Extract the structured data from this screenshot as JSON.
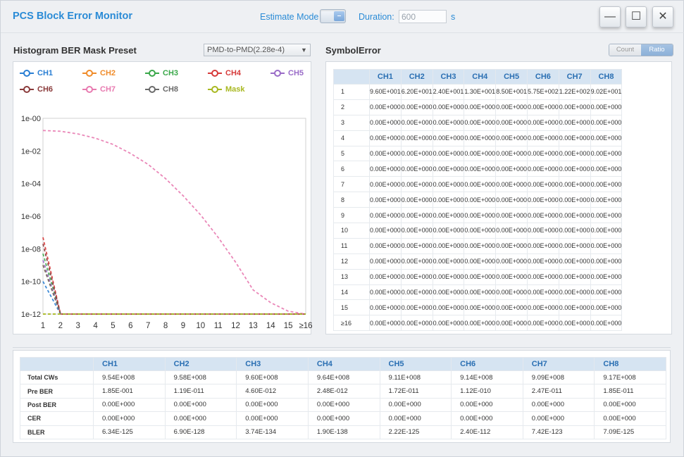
{
  "window": {
    "title": "PCS Block Error Monitor",
    "estimate_mode_label": "Estimate Mode",
    "estimate_mode_toggle": "–",
    "duration_label": "Duration:",
    "duration_value": "600",
    "duration_unit": "s",
    "minimize": "—",
    "maximize": "☐",
    "close": "✕"
  },
  "histogram": {
    "title": "Histogram BER Mask Preset",
    "preset_value": "PMD-to-PMD(2.28e-4)",
    "preset_arrow": "▼"
  },
  "symbol_error": {
    "title": "SymbolError",
    "modes": [
      "Count",
      "Ratio"
    ],
    "active_mode": "Ratio",
    "columns": [
      "",
      "CH1",
      "CH2",
      "CH3",
      "CH4",
      "CH5",
      "CH6",
      "CH7",
      "CH8"
    ],
    "rows": [
      [
        "1",
        "9.60E+001",
        "6.20E+001",
        "2.40E+001",
        "1.30E+001",
        "8.50E+001",
        "5.75E+002",
        "1.22E+002",
        "9.02E+001"
      ],
      [
        "2",
        "0.00E+000",
        "0.00E+000",
        "0.00E+000",
        "0.00E+000",
        "0.00E+000",
        "0.00E+000",
        "0.00E+000",
        "0.00E+000"
      ],
      [
        "3",
        "0.00E+000",
        "0.00E+000",
        "0.00E+000",
        "0.00E+000",
        "0.00E+000",
        "0.00E+000",
        "0.00E+000",
        "0.00E+000"
      ],
      [
        "4",
        "0.00E+000",
        "0.00E+000",
        "0.00E+000",
        "0.00E+000",
        "0.00E+000",
        "0.00E+000",
        "0.00E+000",
        "0.00E+000"
      ],
      [
        "5",
        "0.00E+000",
        "0.00E+000",
        "0.00E+000",
        "0.00E+000",
        "0.00E+000",
        "0.00E+000",
        "0.00E+000",
        "0.00E+000"
      ],
      [
        "6",
        "0.00E+000",
        "0.00E+000",
        "0.00E+000",
        "0.00E+000",
        "0.00E+000",
        "0.00E+000",
        "0.00E+000",
        "0.00E+000"
      ],
      [
        "7",
        "0.00E+000",
        "0.00E+000",
        "0.00E+000",
        "0.00E+000",
        "0.00E+000",
        "0.00E+000",
        "0.00E+000",
        "0.00E+000"
      ],
      [
        "8",
        "0.00E+000",
        "0.00E+000",
        "0.00E+000",
        "0.00E+000",
        "0.00E+000",
        "0.00E+000",
        "0.00E+000",
        "0.00E+000"
      ],
      [
        "9",
        "0.00E+000",
        "0.00E+000",
        "0.00E+000",
        "0.00E+000",
        "0.00E+000",
        "0.00E+000",
        "0.00E+000",
        "0.00E+000"
      ],
      [
        "10",
        "0.00E+000",
        "0.00E+000",
        "0.00E+000",
        "0.00E+000",
        "0.00E+000",
        "0.00E+000",
        "0.00E+000",
        "0.00E+000"
      ],
      [
        "11",
        "0.00E+000",
        "0.00E+000",
        "0.00E+000",
        "0.00E+000",
        "0.00E+000",
        "0.00E+000",
        "0.00E+000",
        "0.00E+000"
      ],
      [
        "12",
        "0.00E+000",
        "0.00E+000",
        "0.00E+000",
        "0.00E+000",
        "0.00E+000",
        "0.00E+000",
        "0.00E+000",
        "0.00E+000"
      ],
      [
        "13",
        "0.00E+000",
        "0.00E+000",
        "0.00E+000",
        "0.00E+000",
        "0.00E+000",
        "0.00E+000",
        "0.00E+000",
        "0.00E+000"
      ],
      [
        "14",
        "0.00E+000",
        "0.00E+000",
        "0.00E+000",
        "0.00E+000",
        "0.00E+000",
        "0.00E+000",
        "0.00E+000",
        "0.00E+000"
      ],
      [
        "15",
        "0.00E+000",
        "0.00E+000",
        "0.00E+000",
        "0.00E+000",
        "0.00E+000",
        "0.00E+000",
        "0.00E+000",
        "0.00E+000"
      ],
      [
        "≥16",
        "0.00E+000",
        "0.00E+000",
        "0.00E+000",
        "0.00E+000",
        "0.00E+000",
        "0.00E+000",
        "0.00E+000",
        "0.00E+000"
      ]
    ]
  },
  "stats": {
    "columns": [
      "",
      "CH1",
      "CH2",
      "CH3",
      "CH4",
      "CH5",
      "CH6",
      "CH7",
      "CH8"
    ],
    "rows": [
      [
        "Total CWs",
        "9.54E+008",
        "9.58E+008",
        "9.60E+008",
        "9.64E+008",
        "9.11E+008",
        "9.14E+008",
        "9.09E+008",
        "9.17E+008"
      ],
      [
        "Pre BER",
        "1.85E-001",
        "1.19E-011",
        "4.60E-012",
        "2.48E-012",
        "1.72E-011",
        "1.12E-010",
        "2.47E-011",
        "1.85E-011"
      ],
      [
        "Post BER",
        "0.00E+000",
        "0.00E+000",
        "0.00E+000",
        "0.00E+000",
        "0.00E+000",
        "0.00E+000",
        "0.00E+000",
        "0.00E+000"
      ],
      [
        "CER",
        "0.00E+000",
        "0.00E+000",
        "0.00E+000",
        "0.00E+000",
        "0.00E+000",
        "0.00E+000",
        "0.00E+000",
        "0.00E+000"
      ],
      [
        "BLER",
        "6.34E-125",
        "6.90E-128",
        "3.74E-134",
        "1.90E-138",
        "2.22E-125",
        "2.40E-112",
        "7.42E-123",
        "7.09E-125"
      ]
    ]
  },
  "chart_data": {
    "type": "line",
    "scale": "log",
    "grid": false,
    "legend_placement": "top",
    "x": [
      "1",
      "2",
      "3",
      "4",
      "5",
      "6",
      "7",
      "8",
      "9",
      "10",
      "11",
      "12",
      "13",
      "14",
      "15",
      "≥16"
    ],
    "ylim": [
      1e-12,
      1
    ],
    "ytick_labels": [
      "1e-00",
      "1e-02",
      "1e-04",
      "1e-06",
      "1e-08",
      "1e-10",
      "1e-12"
    ],
    "series": [
      {
        "name": "CH1",
        "color": "#2a7fd4",
        "values": [
          1e-10,
          1e-12,
          1e-12,
          1e-12,
          1e-12,
          1e-12,
          1e-12,
          1e-12,
          1e-12,
          1e-12,
          1e-12,
          1e-12,
          1e-12,
          1e-12,
          1e-12,
          1e-12
        ]
      },
      {
        "name": "CH2",
        "color": "#f08c2a",
        "values": [
          1e-09,
          1e-12,
          1e-12,
          1e-12,
          1e-12,
          1e-12,
          1e-12,
          1e-12,
          1e-12,
          1e-12,
          1e-12,
          1e-12,
          1e-12,
          1e-12,
          1e-12,
          1e-12
        ]
      },
      {
        "name": "CH3",
        "color": "#3aa84a",
        "values": [
          5e-09,
          1e-12,
          1e-12,
          1e-12,
          1e-12,
          1e-12,
          1e-12,
          1e-12,
          1e-12,
          1e-12,
          1e-12,
          1e-12,
          1e-12,
          1e-12,
          1e-12,
          1e-12
        ]
      },
      {
        "name": "CH4",
        "color": "#d63a3a",
        "values": [
          5e-08,
          1e-12,
          1e-12,
          1e-12,
          1e-12,
          1e-12,
          1e-12,
          1e-12,
          1e-12,
          1e-12,
          1e-12,
          1e-12,
          1e-12,
          1e-12,
          1e-12,
          1e-12
        ]
      },
      {
        "name": "CH5",
        "color": "#9a6cc8",
        "values": [
          2e-09,
          1e-12,
          1e-12,
          1e-12,
          1e-12,
          1e-12,
          1e-12,
          1e-12,
          1e-12,
          1e-12,
          1e-12,
          1e-12,
          1e-12,
          1e-12,
          1e-12,
          1e-12
        ]
      },
      {
        "name": "CH6",
        "color": "#8a3a3a",
        "values": [
          2e-08,
          1e-12,
          1e-12,
          1e-12,
          1e-12,
          1e-12,
          1e-12,
          1e-12,
          1e-12,
          1e-12,
          1e-12,
          1e-12,
          1e-12,
          1e-12,
          1e-12,
          1e-12
        ]
      },
      {
        "name": "CH7",
        "color": "#e87ab0",
        "values": [
          0.18,
          0.16,
          0.11,
          0.06,
          0.025,
          0.007,
          0.0015,
          0.0002,
          1.8e-05,
          1.2e-06,
          5e-08,
          1.5e-09,
          3e-11,
          5e-12,
          1.5e-12,
          1e-12
        ]
      },
      {
        "name": "CH8",
        "color": "#6a6a6a",
        "values": [
          1e-09,
          1e-12,
          1e-12,
          1e-12,
          1e-12,
          1e-12,
          1e-12,
          1e-12,
          1e-12,
          1e-12,
          1e-12,
          1e-12,
          1e-12,
          1e-12,
          1e-12,
          1e-12
        ]
      },
      {
        "name": "Mask",
        "color": "#a8b820",
        "values": [
          1e-12,
          1e-12,
          1e-12,
          1e-12,
          1e-12,
          1e-12,
          1e-12,
          1e-12,
          1e-12,
          1e-12,
          1e-12,
          1e-12,
          1e-12,
          1e-12,
          1e-12,
          1e-12
        ]
      }
    ]
  }
}
